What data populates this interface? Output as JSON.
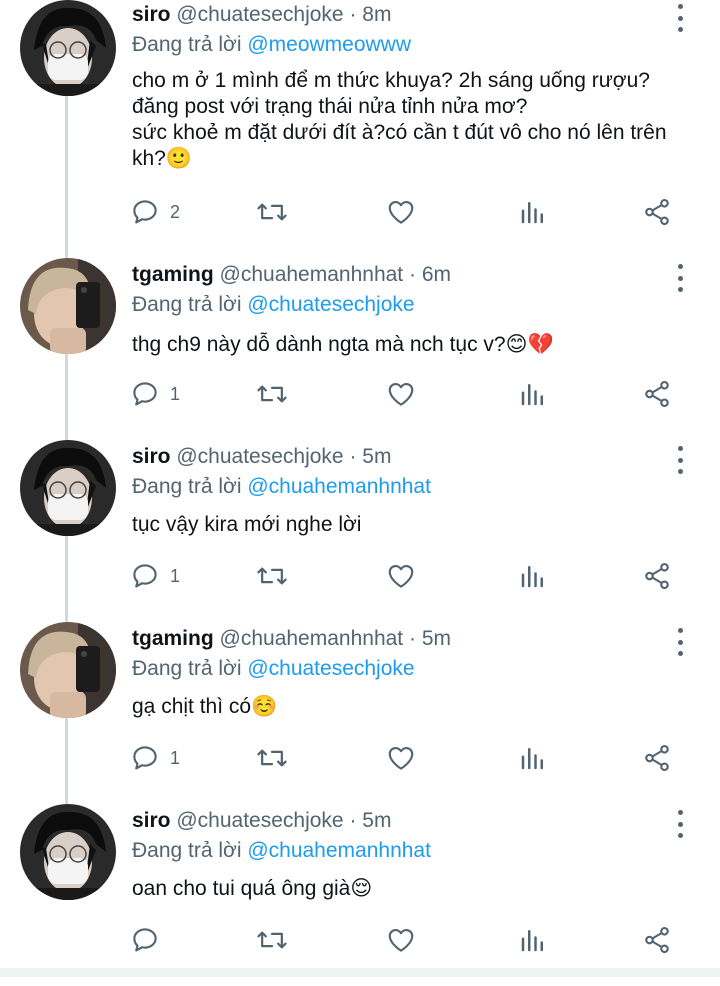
{
  "tweets": [
    {
      "name": "siro",
      "handle": "@chuatesechjoke",
      "time": "8m",
      "reply_prefix": "Đang trả lời",
      "reply_to": "@meowmeowww",
      "body": "cho m ở 1 mình để m thức khuya? 2h sáng uống rượu?\nđăng post với trạng thái nửa tỉnh nửa mơ?\nsức khoẻ m đặt dưới đít à?có cần t đút vô cho nó lên trên\nkh?🙂",
      "reply_count": "2",
      "avatar": "siro-avatar"
    },
    {
      "name": "tgaming",
      "handle": "@chuahemanhnhat",
      "time": "6m",
      "reply_prefix": "Đang trả lời",
      "reply_to": "@chuatesechjoke",
      "body": "thg ch9 này dỗ dành ngta mà nch tục v?😊💔",
      "reply_count": "1",
      "avatar": "tgaming-avatar"
    },
    {
      "name": "siro",
      "handle": "@chuatesechjoke",
      "time": "5m",
      "reply_prefix": "Đang trả lời",
      "reply_to": "@chuahemanhnhat",
      "body": "tục vậy kira mới nghe lời",
      "reply_count": "1",
      "avatar": "siro-avatar"
    },
    {
      "name": "tgaming",
      "handle": "@chuahemanhnhat",
      "time": "5m",
      "reply_prefix": "Đang trả lời",
      "reply_to": "@chuatesechjoke",
      "body": "gạ chịt thì có☺️",
      "reply_count": "1",
      "avatar": "tgaming-avatar"
    },
    {
      "name": "siro",
      "handle": "@chuatesechjoke",
      "time": "5m",
      "reply_prefix": "Đang trả lời",
      "reply_to": "@chuahemanhnhat",
      "body": "oan cho tui quá ông già😌",
      "reply_count": "",
      "avatar": "siro-avatar"
    }
  ],
  "separator": " · ",
  "colors": {
    "accent": "#1d9bf0",
    "secondary_text": "#536471",
    "primary_text": "#0f1419",
    "thread_line": "#cfd9de"
  },
  "icons": [
    "reply-icon",
    "retweet-icon",
    "like-icon",
    "stats-icon",
    "share-icon",
    "more-options-icon"
  ]
}
